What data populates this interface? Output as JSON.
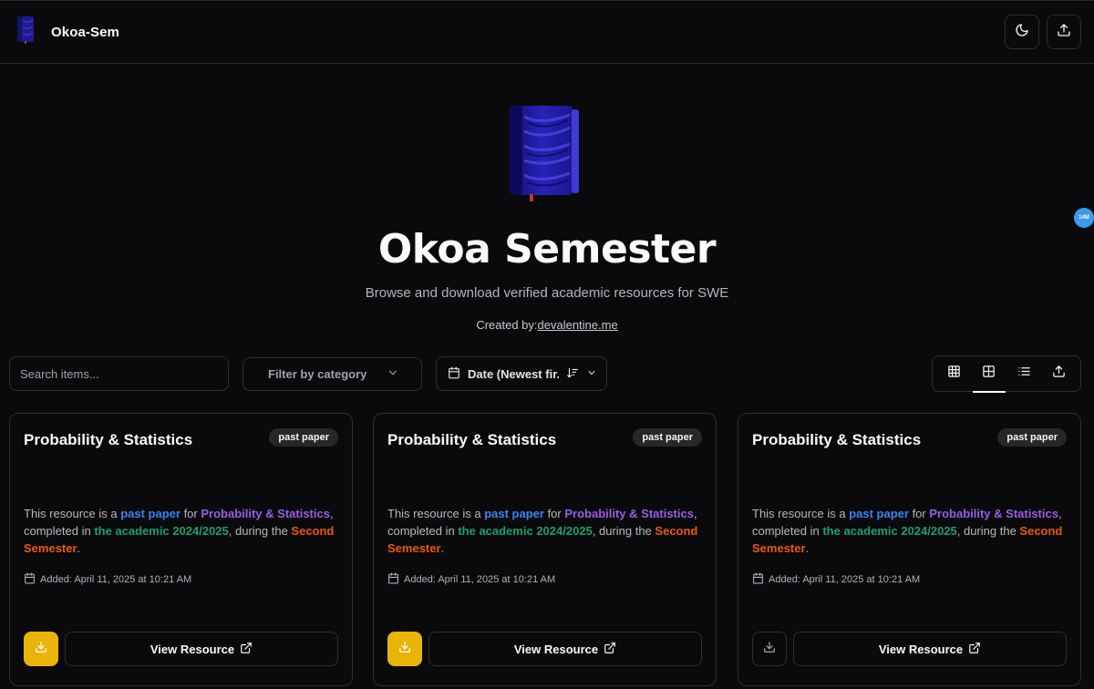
{
  "header": {
    "brand_title": "Okoa-Sem",
    "theme_toggle_icon": "moon-icon",
    "upload_icon": "upload-icon"
  },
  "hero": {
    "title": "Okoa Semester",
    "subtitle": "Browse and download verified academic resources for SWE",
    "credit_prefix": "Created by:",
    "credit_link": "devalentine.me"
  },
  "controls": {
    "search_placeholder": "Search items...",
    "filter_label": "Filter by category",
    "sort_label": "Date (Newest fir...",
    "view_modes": [
      "grid-dense-icon",
      "grid-icon",
      "list-icon",
      "upload-icon"
    ]
  },
  "floating_badge": "14M",
  "cards": [
    {
      "title": "Probability & Statistics",
      "badge": "past paper",
      "desc_1": "This resource is a ",
      "type": "past paper",
      "desc_2": " for ",
      "course": "Probability & Statistics",
      "desc_3": ", completed in ",
      "year": "the academic 2024/2025",
      "desc_4": ", during the ",
      "semester": "Second Semester",
      "desc_5": ".",
      "added": "Added: April 11, 2025 at 10:21 AM",
      "view_label": "View Resource",
      "download_style": "yellow"
    },
    {
      "title": "Probability & Statistics",
      "badge": "past paper",
      "desc_1": "This resource is a ",
      "type": "past paper",
      "desc_2": " for ",
      "course": "Probability & Statistics",
      "desc_3": ", completed in ",
      "year": "the academic 2024/2025",
      "desc_4": ", during the ",
      "semester": "Second Semester",
      "desc_5": ".",
      "added": "Added: April 11, 2025 at 10:21 AM",
      "view_label": "View Resource",
      "download_style": "yellow"
    },
    {
      "title": "Probability & Statistics",
      "badge": "past paper",
      "desc_1": "This resource is a ",
      "type": "past paper",
      "desc_2": " for ",
      "course": "Probability & Statistics",
      "desc_3": ", completed in ",
      "year": "the academic 2024/2025",
      "desc_4": ", during the ",
      "semester": "Second Semester",
      "desc_5": ".",
      "added": "Added: April 11, 2025 at 10:21 AM",
      "view_label": "View Resource",
      "download_style": "plain"
    }
  ],
  "colors": {
    "background": "#0a0a0c",
    "download_accent": "#eab308",
    "type_highlight": "#3b82f6",
    "course_highlight": "#9b5de5",
    "year_highlight": "#1f9e6e",
    "semester_highlight": "#ea580c"
  }
}
